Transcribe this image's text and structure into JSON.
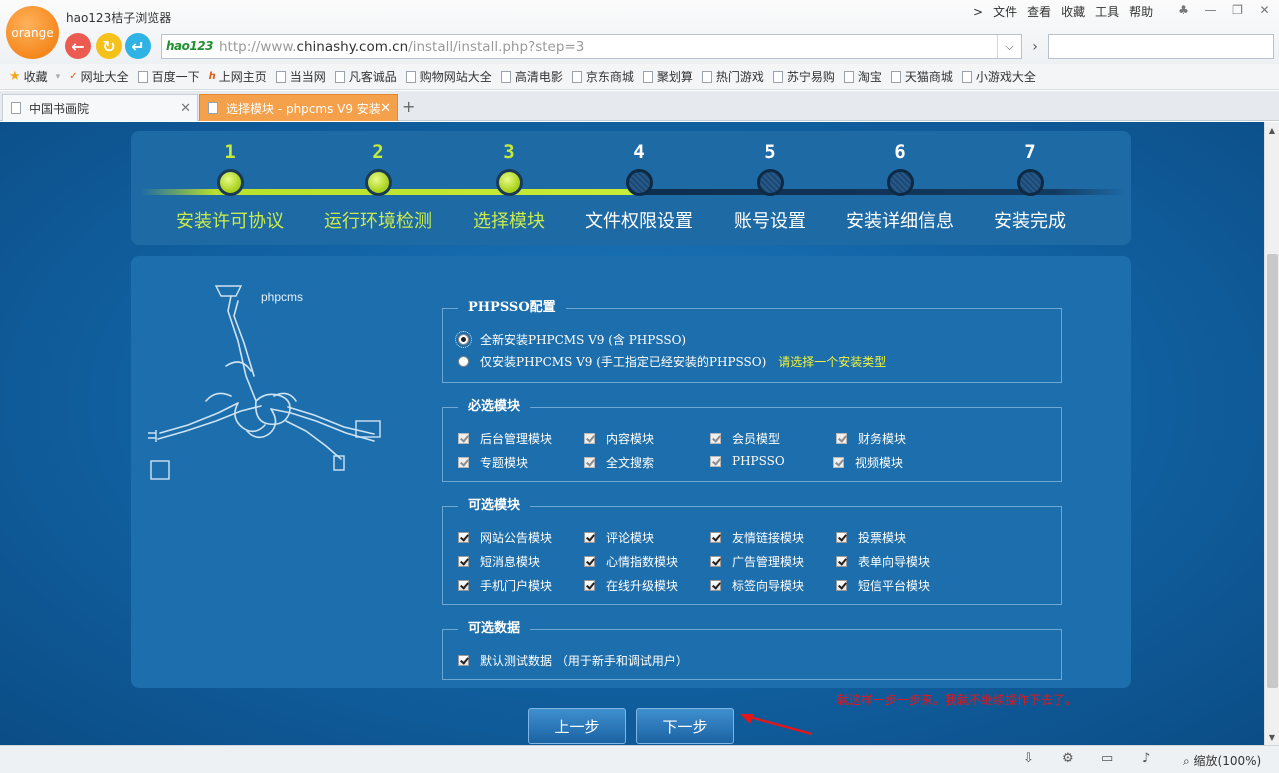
{
  "browser": {
    "logo_text": "orange",
    "app_title": "hao123桔子浏览器",
    "menu": [
      "文件",
      "查看",
      "收藏",
      "工具",
      "帮助"
    ],
    "address": {
      "logo": "hao123",
      "url_prefix": "http://www.",
      "url_domain": "chinashy.com.cn",
      "url_path": "/install/install.php?step=3"
    },
    "search_value": "",
    "bookmarks": [
      "收藏",
      "网址大全",
      "百度一下",
      "上网主页",
      "当当网",
      "凡客诚品",
      "购物网站大全",
      "高清电影",
      "京东商城",
      "聚划算",
      "热门游戏",
      "苏宁易购",
      "淘宝",
      "天猫商城",
      "小游戏大全"
    ],
    "tabs": [
      {
        "label": "中国书画院"
      },
      {
        "label": "选择模块 - phpcms V9 安装"
      }
    ],
    "zoom": "缩放(100%)"
  },
  "steps": [
    {
      "num": "1",
      "label": "安装许可协议",
      "state": "done"
    },
    {
      "num": "2",
      "label": "运行环境检测",
      "state": "done"
    },
    {
      "num": "3",
      "label": "选择模块",
      "state": "done"
    },
    {
      "num": "4",
      "label": "文件权限设置",
      "state": "todo"
    },
    {
      "num": "5",
      "label": "账号设置",
      "state": "todo"
    },
    {
      "num": "6",
      "label": "安装详细信息",
      "state": "todo"
    },
    {
      "num": "7",
      "label": "安装完成",
      "state": "todo"
    }
  ],
  "illustration_label": "phpcms",
  "phpsso": {
    "legend": "PHPSSO配置",
    "options": [
      {
        "label": "全新安装PHPCMS V9 (含 PHPSSO)",
        "checked": true
      },
      {
        "label": "仅安装PHPCMS V9 (手工指定已经安装的PHPSSO)",
        "checked": false
      }
    ],
    "hint": "请选择一个安装类型"
  },
  "required": {
    "legend": "必选模块",
    "items": [
      "后台管理模块",
      "内容模块",
      "会员模型",
      "财务模块",
      "专题模块",
      "全文搜索",
      "PHPSSO",
      "视频模块"
    ]
  },
  "optional": {
    "legend": "可选模块",
    "items": [
      "网站公告模块",
      "评论模块",
      "友情链接模块",
      "投票模块",
      "短消息模块",
      "心情指数模块",
      "广告管理模块",
      "表单向导模块",
      "手机门户模块",
      "在线升级模块",
      "标签向导模块",
      "短信平台模块"
    ]
  },
  "data": {
    "legend": "可选数据",
    "item": "默认测试数据 （用于新手和调试用户）"
  },
  "buttons": {
    "prev": "上一步",
    "next": "下一步"
  },
  "annotation": "就这样一步一步来。我就不继续操作下去了。",
  "colors": {
    "accent": "#f5a04a",
    "done": "#c6ea3a",
    "page_bg": "#1264a6",
    "annotation": "#e2171b"
  }
}
